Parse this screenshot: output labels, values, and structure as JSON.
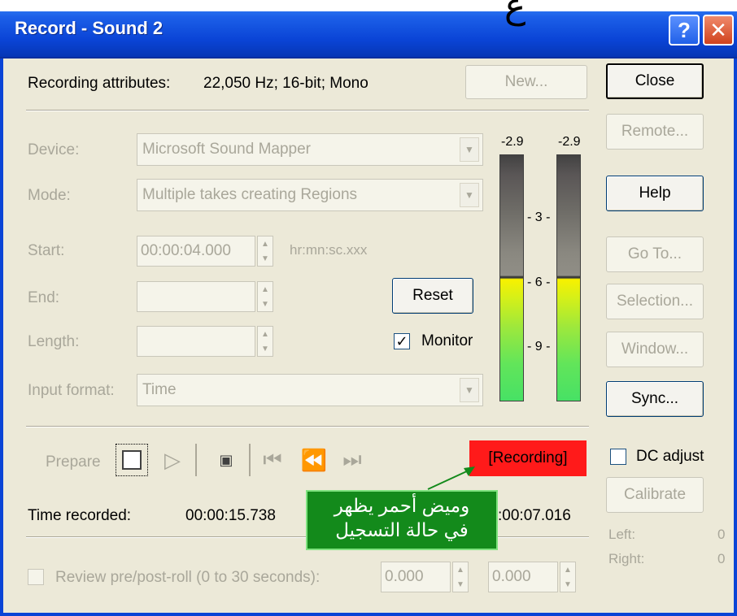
{
  "window": {
    "title": "Record - Sound 2",
    "help_glyph": "?",
    "close_glyph": "✕",
    "overflow_glyph": "ع"
  },
  "attributes": {
    "label": "Recording attributes:",
    "value": "22,050 Hz; 16-bit; Mono"
  },
  "buttons": {
    "new": "New...",
    "close": "Close",
    "remote": "Remote...",
    "help": "Help",
    "goto": "Go To...",
    "selection": "Selection...",
    "window": "Window...",
    "sync": "Sync...",
    "reset": "Reset",
    "calibrate": "Calibrate"
  },
  "form": {
    "device_label": "Device:",
    "device_value": "Microsoft Sound Mapper",
    "mode_label": "Mode:",
    "mode_value": "Multiple takes creating Regions",
    "start_label": "Start:",
    "start_value": "00:00:04.000",
    "start_hint": "hr:mn:sc.xxx",
    "end_label": "End:",
    "end_value": "",
    "length_label": "Length:",
    "length_value": "",
    "input_format_label": "Input format:",
    "input_format_value": "Time",
    "monitor_label": "Monitor",
    "monitor_checked": true
  },
  "meters": {
    "left_peak": "-2.9",
    "right_peak": "-2.9",
    "ticks": [
      "3",
      "6",
      "9"
    ]
  },
  "transport": {
    "prepare_label": "Prepare",
    "status": "[Recording]",
    "status_color": "#ff1a1a",
    "icons": [
      "record-stop-icon",
      "play-icon",
      "marker-icon",
      "go-to-start-icon",
      "rewind-icon",
      "go-to-end-icon"
    ]
  },
  "times": {
    "recorded_label": "Time recorded:",
    "recorded_value": "00:00:15.738",
    "other_value": ":00:07.016"
  },
  "callout": {
    "line1": "وميض أحمر يظهر",
    "line2": "في حالة التسجيل",
    "color": "#138a1b"
  },
  "dc": {
    "label": "DC adjust",
    "checked": false
  },
  "levels": {
    "left_label": "Left:",
    "left_value": "0",
    "right_label": "Right:",
    "right_value": "0"
  },
  "review": {
    "label": "Review pre/post-roll (0 to 30 seconds):",
    "pre_value": "0.000",
    "post_value": "0.000"
  }
}
